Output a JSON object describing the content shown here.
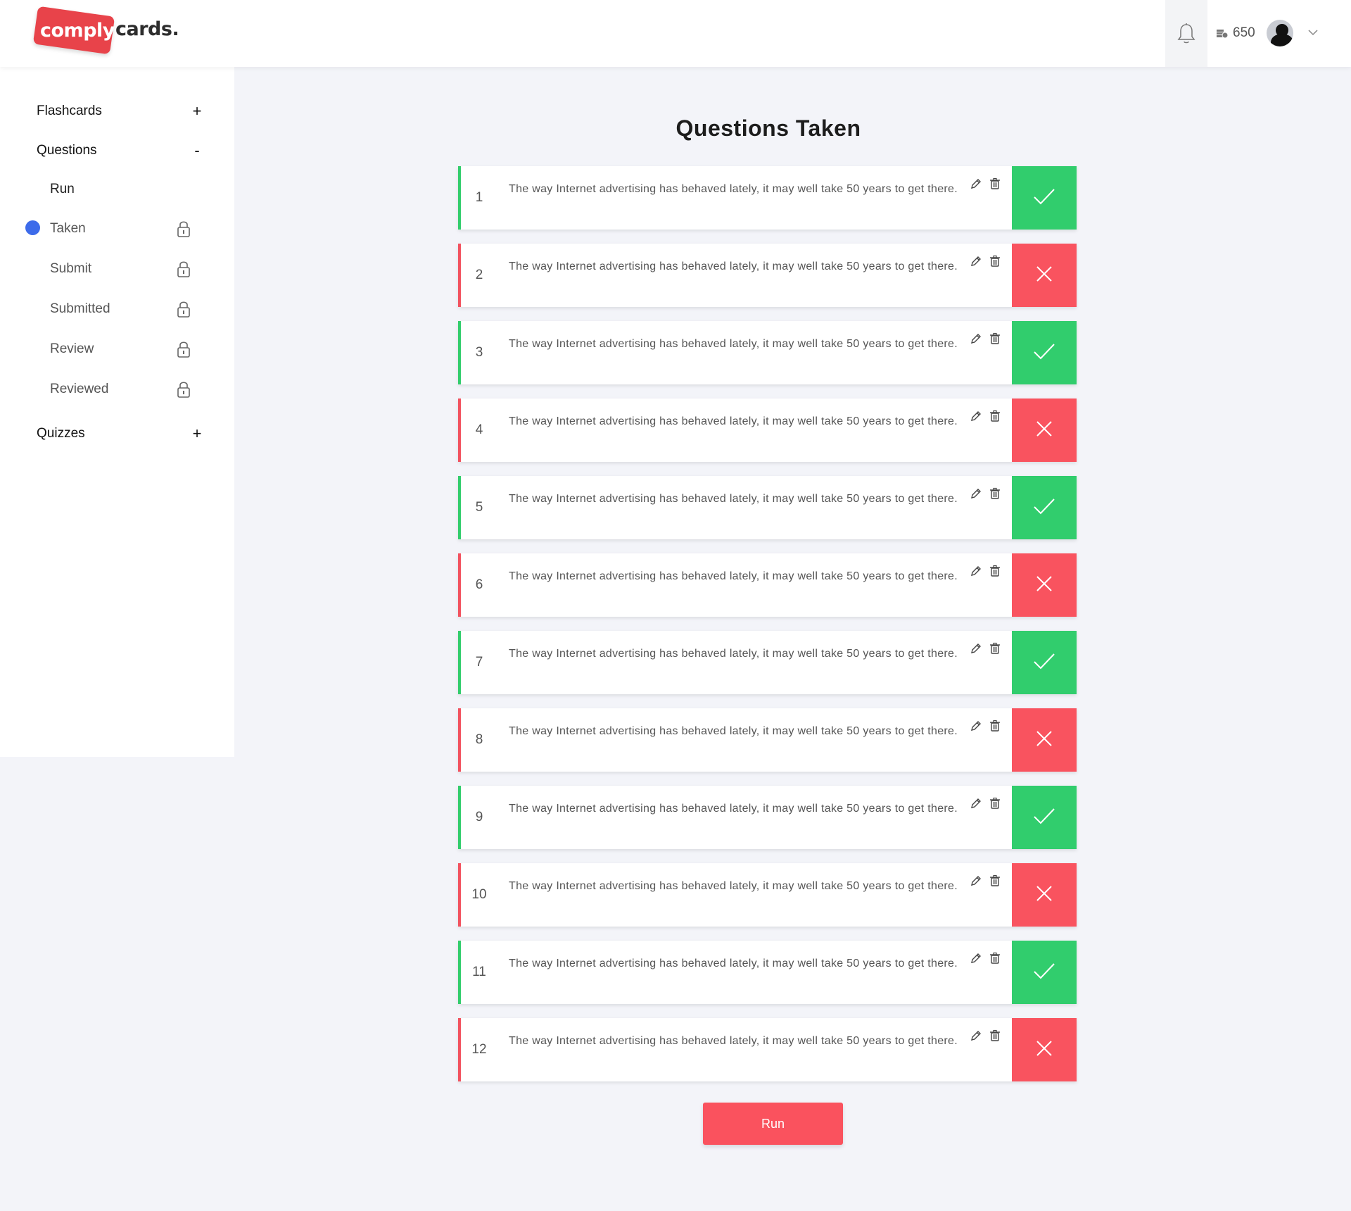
{
  "brand": {
    "logo_primary": "comply.",
    "logo_secondary": "cards."
  },
  "header": {
    "coins": "650",
    "notifications_icon": "bell-icon",
    "coins_icon": "coins-icon"
  },
  "sidebar": {
    "sections": [
      {
        "label": "Flashcards",
        "toggle": "+"
      },
      {
        "label": "Questions",
        "toggle": "-"
      },
      {
        "label": "Quizzes",
        "toggle": "+"
      }
    ],
    "question_items": [
      {
        "label": "Run",
        "locked": false,
        "active": false
      },
      {
        "label": "Taken",
        "locked": true,
        "active": true
      },
      {
        "label": "Submit",
        "locked": true,
        "active": false
      },
      {
        "label": "Submitted",
        "locked": true,
        "active": false
      },
      {
        "label": "Review",
        "locked": true,
        "active": false
      },
      {
        "label": "Reviewed",
        "locked": true,
        "active": false
      }
    ]
  },
  "main": {
    "title": "Questions Taken",
    "questions": [
      {
        "number": "1",
        "text": "The way Internet advertising has behaved lately, it may well take 50 years to get there.",
        "status": "correct"
      },
      {
        "number": "2",
        "text": "The way Internet advertising has behaved lately, it may well take 50 years to get there.",
        "status": "wrong"
      },
      {
        "number": "3",
        "text": "The way Internet advertising has behaved lately, it may well take 50 years to get there.",
        "status": "correct"
      },
      {
        "number": "4",
        "text": "The way Internet advertising has behaved lately, it may well take 50 years to get there.",
        "status": "wrong"
      },
      {
        "number": "5",
        "text": "The way Internet advertising has behaved lately, it may well take 50 years to get there.",
        "status": "correct"
      },
      {
        "number": "6",
        "text": "The way Internet advertising has behaved lately, it may well take 50 years to get there.",
        "status": "wrong"
      },
      {
        "number": "7",
        "text": "The way Internet advertising has behaved lately, it may well take 50 years to get there.",
        "status": "correct"
      },
      {
        "number": "8",
        "text": "The way Internet advertising has behaved lately, it may well take 50 years to get there.",
        "status": "wrong"
      },
      {
        "number": "9",
        "text": "The way Internet advertising has behaved lately, it may well take 50 years to get there.",
        "status": "correct"
      },
      {
        "number": "10",
        "text": "The way Internet advertising has behaved lately, it may well take 50 years to get there.",
        "status": "wrong"
      },
      {
        "number": "11",
        "text": "The way Internet advertising has behaved lately, it may well take 50 years to get there.",
        "status": "correct"
      },
      {
        "number": "12",
        "text": "The way Internet advertising has behaved lately, it may well take 50 years to get there.",
        "status": "wrong"
      }
    ],
    "run_label": "Run"
  },
  "colors": {
    "accent": "#fa525e",
    "correct": "#31cd6d",
    "wrong": "#f9535f",
    "active_dot": "#3d6bea"
  }
}
